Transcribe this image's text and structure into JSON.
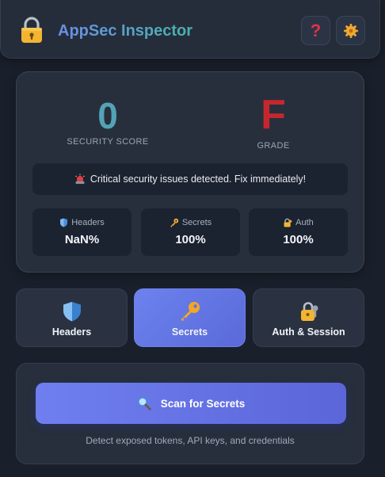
{
  "header": {
    "title": "AppSec Inspector",
    "logo_icon": "padlock-icon",
    "help_icon": "question-mark-icon",
    "settings_icon": "gear-icon"
  },
  "score": {
    "value": "0",
    "label": "SECURITY SCORE",
    "grade": "F",
    "grade_label": "GRADE",
    "alert": "Critical security issues detected. Fix immediately!",
    "alert_icon": "siren-icon",
    "metrics": [
      {
        "label": "Headers",
        "value": "NaN%",
        "icon": "shield-icon"
      },
      {
        "label": "Secrets",
        "value": "100%",
        "icon": "key-icon"
      },
      {
        "label": "Auth",
        "value": "100%",
        "icon": "lock-key-icon"
      }
    ]
  },
  "tabs": [
    {
      "label": "Headers",
      "icon": "shield-icon",
      "active": false
    },
    {
      "label": "Secrets",
      "icon": "key-icon",
      "active": true
    },
    {
      "label": "Auth & Session",
      "icon": "lock-key-icon",
      "active": false
    }
  ],
  "scan": {
    "button_label": "Scan for Secrets",
    "button_icon": "magnifier-icon",
    "hint": "Detect exposed tokens, API keys, and credentials"
  },
  "colors": {
    "background": "#1a202b",
    "accent": "#6c7ff0",
    "score": "#52a3b5",
    "grade_fail": "#c4282e",
    "danger": "#e0324a"
  }
}
